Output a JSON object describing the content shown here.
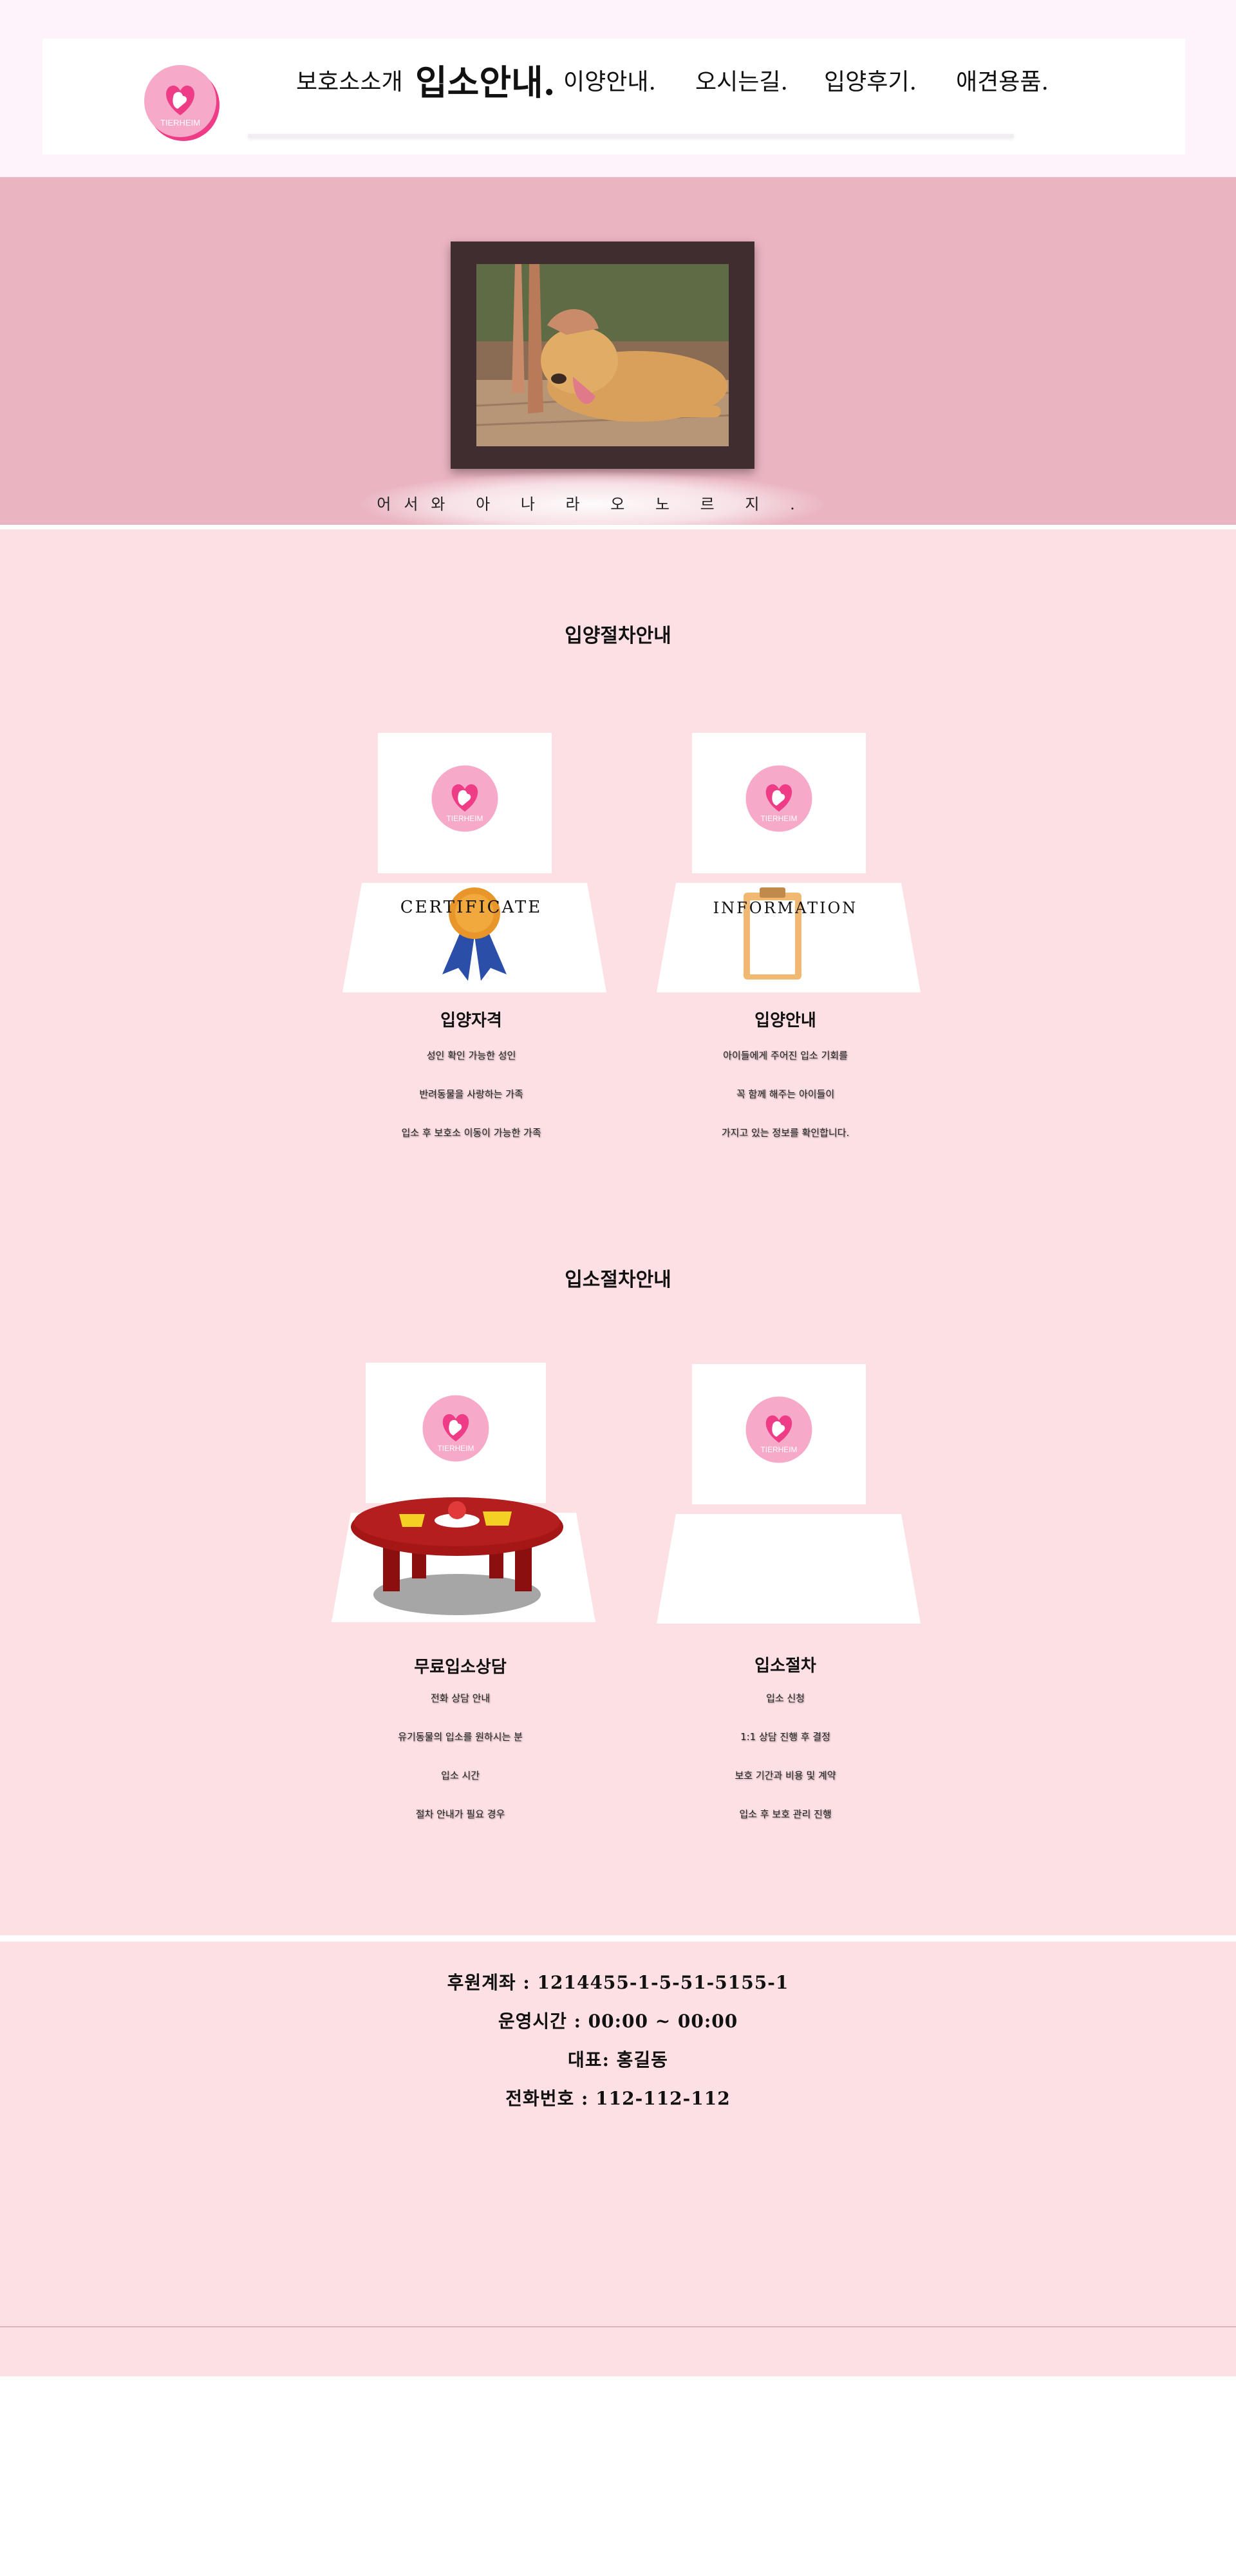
{
  "brand": {
    "logo_text": "TIERHEIM",
    "pink": "#f5a3c8",
    "heart": "#ee3d86"
  },
  "nav": {
    "items": [
      {
        "label": "보호소소개"
      },
      {
        "label": "입소안내.",
        "active": true
      },
      {
        "label": "이양안내."
      },
      {
        "label": "오시는길."
      },
      {
        "label": "입양후기."
      },
      {
        "label": "애견용품."
      }
    ]
  },
  "hero": {
    "slogan": "어서와 아 나 라 오 노 르 지 .",
    "background": "#eab4c1"
  },
  "adoption_section": {
    "title": "입양절차안내",
    "cards": [
      {
        "overlay_label": "CERTIFICATE",
        "title": "입양자격",
        "lines": [
          "성인 확인 가능한 성인",
          "반려동물을 사랑하는 가족",
          "입소 후 보호소 이동이 가능한 가족"
        ]
      },
      {
        "overlay_label": "INFORMATION",
        "title": "입양안내",
        "lines": [
          "아이들에게 주어진 입소 기회를",
          "꼭 함께 해주는 아이들이",
          "가지고 있는 정보를 확인합니다."
        ]
      }
    ]
  },
  "intake_section": {
    "title": "입소절차안내",
    "cards": [
      {
        "title": "무료입소상담",
        "lines": [
          "전화 상담 안내",
          "유기동물의 입소를 원하시는 분",
          "입소 시간",
          "절차 안내가 필요 경우"
        ]
      },
      {
        "title": "입소절차",
        "lines": [
          "입소 신청",
          "1:1 상담 진행 후 결정",
          "보호 기간과 비용 및 계약",
          "입소 후 보호 관리 진행"
        ]
      }
    ]
  },
  "footer": {
    "account": "후원계좌 : 1214455-1-5-51-5155-1",
    "hours": "운영시간 : 00:00 ~ 00:00",
    "ceo": "대표: 홍길동",
    "phone": "전화번호 : 112-112-112"
  }
}
